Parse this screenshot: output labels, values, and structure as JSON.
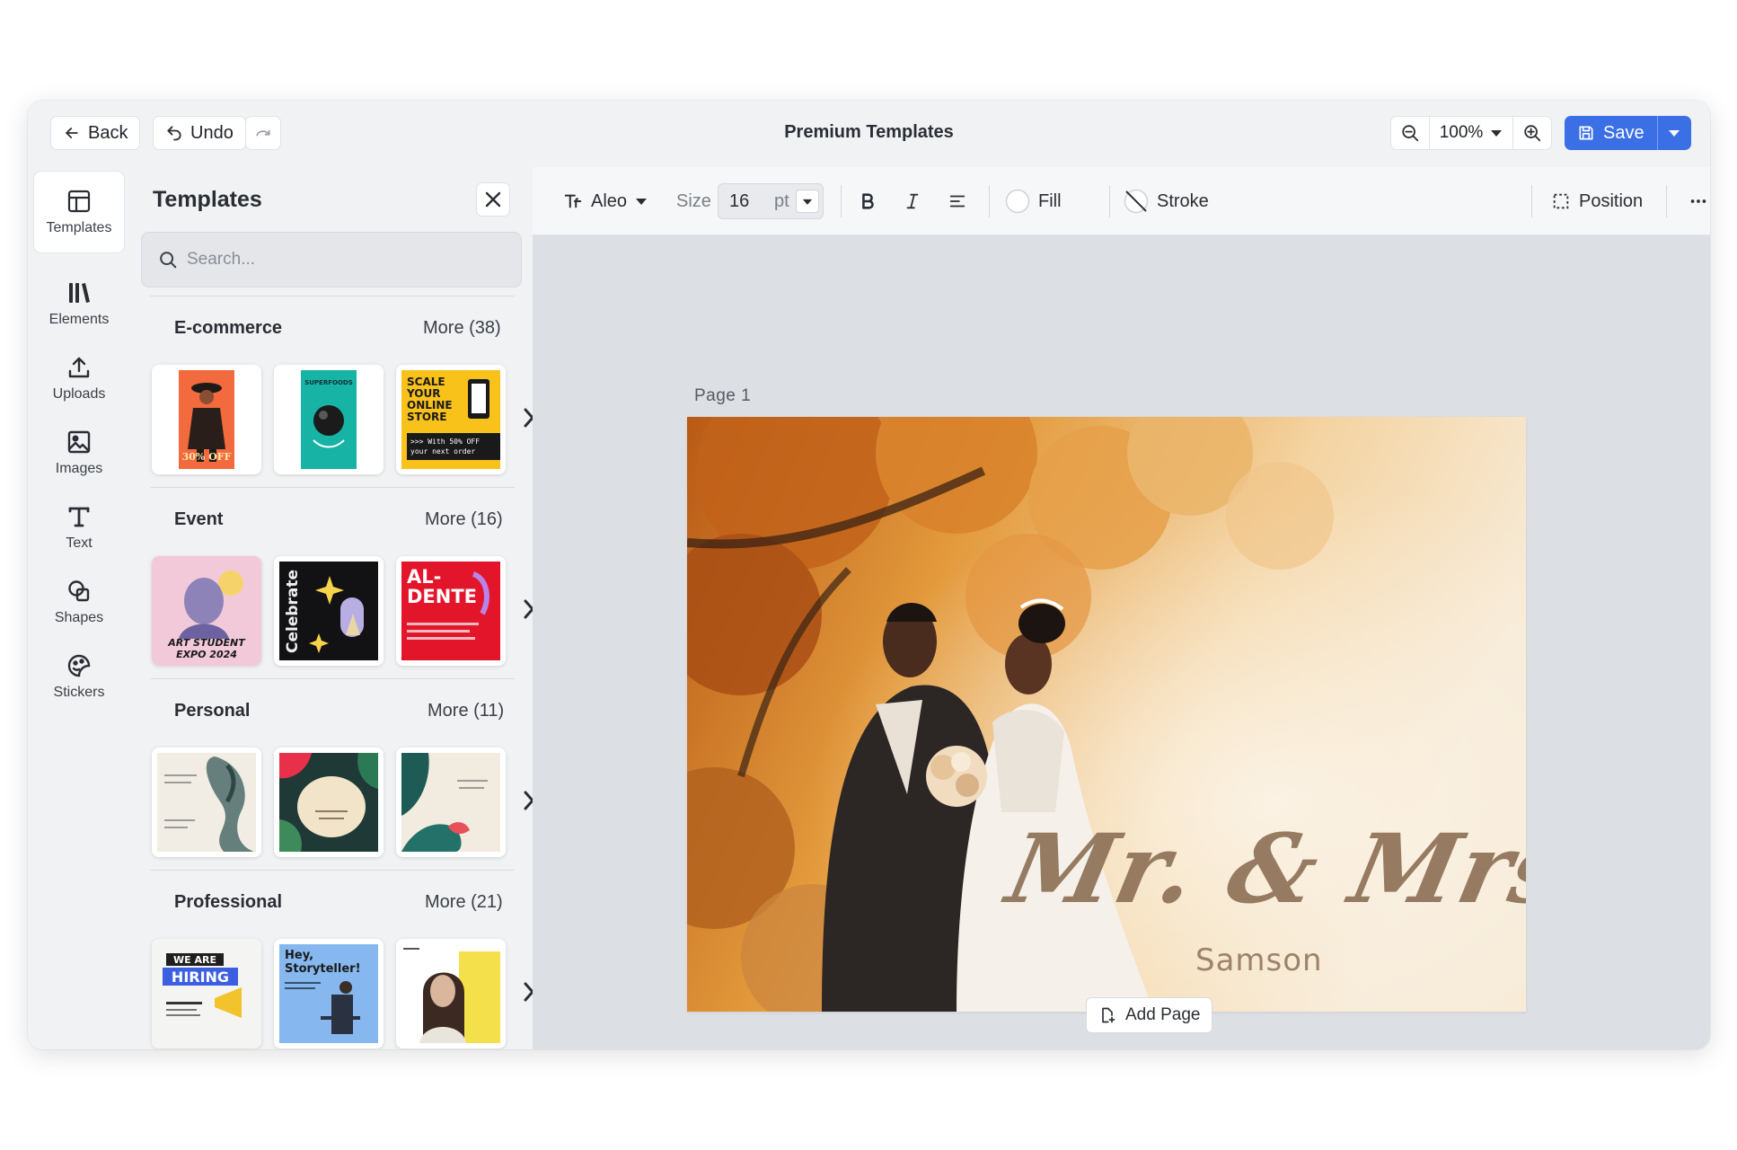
{
  "topbar": {
    "back_label": "Back",
    "undo_label": "Undo",
    "title": "Premium Templates",
    "zoom_value": "100%",
    "save_label": "Save"
  },
  "rail": {
    "items": [
      {
        "label": "Templates",
        "icon": "template-icon"
      },
      {
        "label": "Elements",
        "icon": "elements-icon"
      },
      {
        "label": "Uploads",
        "icon": "upload-icon"
      },
      {
        "label": "Images",
        "icon": "image-icon"
      },
      {
        "label": "Text",
        "icon": "text-icon"
      },
      {
        "label": "Shapes",
        "icon": "shapes-icon"
      },
      {
        "label": "Stickers",
        "icon": "sticker-icon"
      }
    ]
  },
  "panel": {
    "title": "Templates",
    "search_placeholder": "Search...",
    "categories": [
      {
        "name": "E-commerce",
        "more": "More (38)"
      },
      {
        "name": "Event",
        "more": "More (16)"
      },
      {
        "name": "Personal",
        "more": "More (11)"
      },
      {
        "name": "Professional",
        "more": "More (21)"
      }
    ],
    "thumb_text": {
      "ecom_1_off": "30% OFF",
      "ecom_3_headline": [
        "SCALE",
        "YOUR",
        "ONLINE",
        "STORE"
      ],
      "ecom_3_sub": ">>> With 50% OFF",
      "ecom_3_sub2": "your next order",
      "event_1": [
        "ART STUDENT",
        "EXPO 2024"
      ],
      "event_2": "Celebrate",
      "event_3": [
        "AL-",
        "DENTE"
      ],
      "prof_1": [
        "WE ARE",
        "HIRING"
      ],
      "prof_2": [
        "Hey,",
        "Storyteller!"
      ]
    }
  },
  "toolbar": {
    "font_name": "Aleo",
    "size_label": "Size",
    "size_value": "16",
    "size_unit": "pt",
    "fill_label": "Fill",
    "stroke_label": "Stroke",
    "position_label": "Position"
  },
  "canvas": {
    "page_label": "Page  1",
    "headline": "Mr. & Mrs.",
    "subtitle": "Samson",
    "add_page_label": "Add Page"
  },
  "colors": {
    "accent": "#3b6fe5",
    "canvas_bg": "#dcdfe3",
    "panel_bg": "#f1f2f4"
  }
}
